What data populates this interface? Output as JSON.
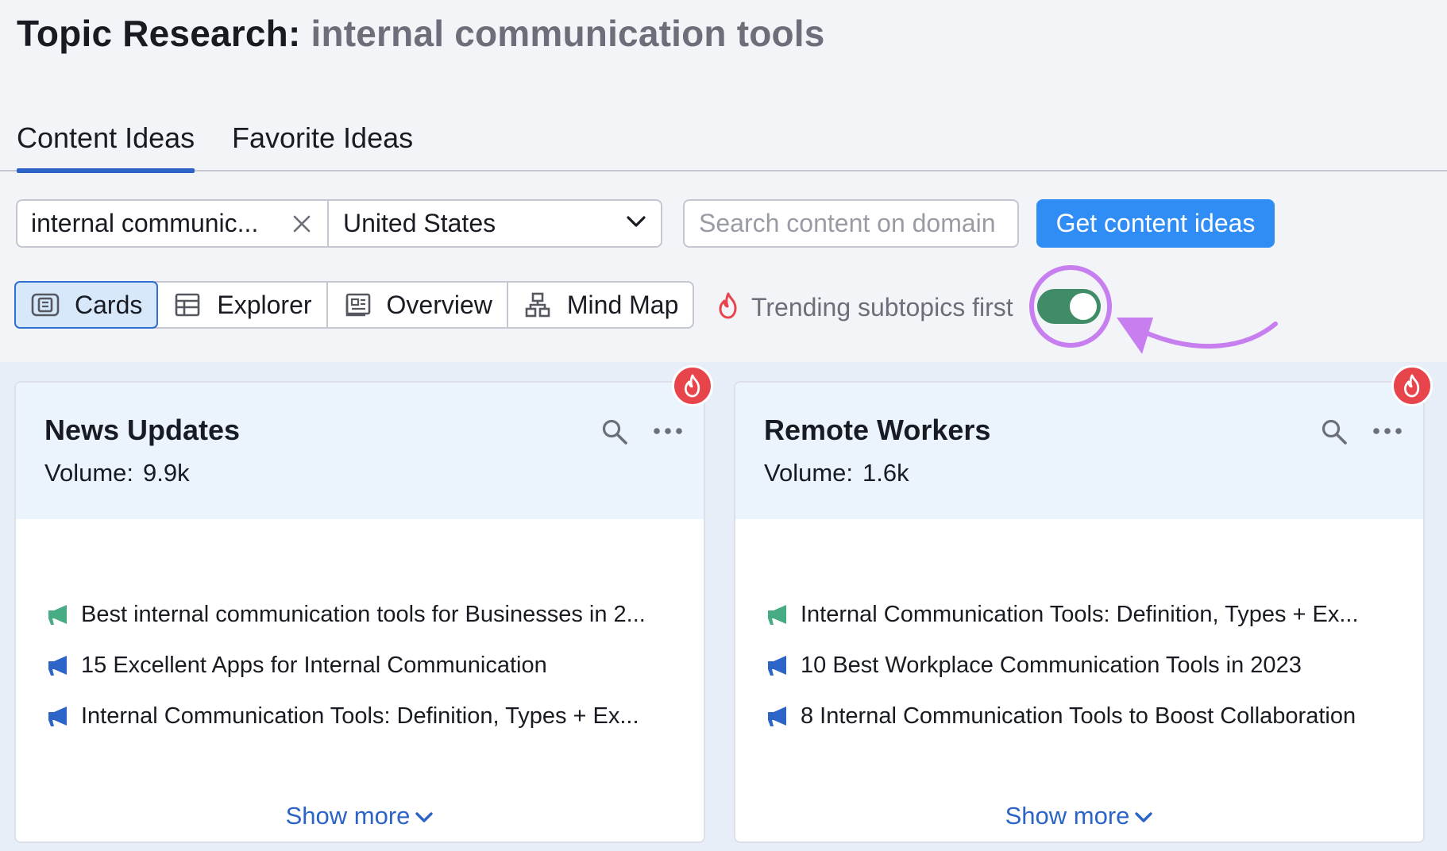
{
  "header": {
    "title_prefix": "Topic Research:",
    "title_query": "internal communication tools"
  },
  "tabs": [
    {
      "label": "Content Ideas",
      "active": true
    },
    {
      "label": "Favorite Ideas",
      "active": false
    }
  ],
  "search": {
    "keyword_value": "internal communic...",
    "country_value": "United States",
    "domain_placeholder": "Search content on domain",
    "submit_label": "Get content ideas"
  },
  "views": [
    {
      "label": "Cards",
      "icon": "cards-icon",
      "active": true
    },
    {
      "label": "Explorer",
      "icon": "table-icon",
      "active": false
    },
    {
      "label": "Overview",
      "icon": "overview-icon",
      "active": false
    },
    {
      "label": "Mind Map",
      "icon": "mind-map-icon",
      "active": false
    }
  ],
  "trending": {
    "label": "Trending subtopics first",
    "enabled": true
  },
  "colors": {
    "accent": "#2f8df5",
    "toggle_on": "#3f8c66",
    "hot": "#e8444c",
    "annotation": "#c77ff0"
  },
  "cards": [
    {
      "title": "News Updates",
      "volume_label": "Volume:",
      "volume": "9.9k",
      "ideas": [
        {
          "text": "Best internal communication tools for Businesses in 2...",
          "type": "green"
        },
        {
          "text": "15 Excellent Apps for Internal Communication",
          "type": "blue"
        },
        {
          "text": "Internal Communication Tools: Definition, Types + Ex...",
          "type": "blue"
        }
      ],
      "show_more": "Show more"
    },
    {
      "title": "Remote Workers",
      "volume_label": "Volume:",
      "volume": "1.6k",
      "ideas": [
        {
          "text": "Internal Communication Tools: Definition, Types + Ex...",
          "type": "green"
        },
        {
          "text": "10 Best Workplace Communication Tools in 2023",
          "type": "blue"
        },
        {
          "text": "8 Internal Communication Tools to Boost Collaboration",
          "type": "blue"
        }
      ],
      "show_more": "Show more"
    }
  ]
}
